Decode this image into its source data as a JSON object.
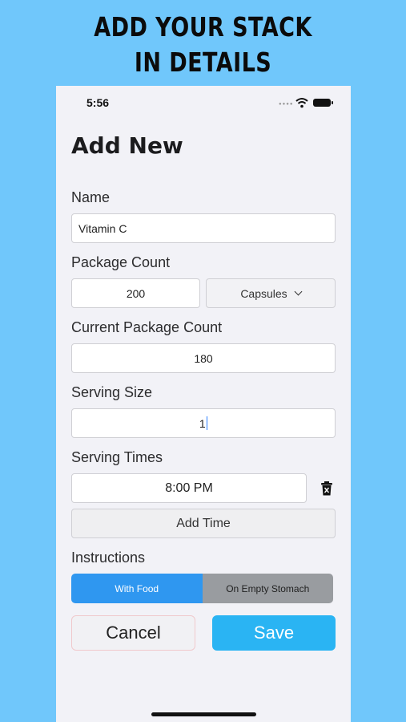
{
  "headline": {
    "line1": "ADD YOUR STACK",
    "line2": "IN DETAILS"
  },
  "status_bar": {
    "time": "5:56",
    "signal_icon": "signal-dots-icon",
    "wifi_icon": "wifi-icon",
    "battery_icon": "battery-icon"
  },
  "page": {
    "title": "Add New"
  },
  "form": {
    "name": {
      "label": "Name",
      "value": "Vitamin C"
    },
    "package_count": {
      "label": "Package Count",
      "value": "200",
      "unit_selected": "Capsules"
    },
    "current_package_count": {
      "label": "Current Package Count",
      "value": "180"
    },
    "serving_size": {
      "label": "Serving Size",
      "value": "1"
    },
    "serving_times": {
      "label": "Serving Times",
      "times": [
        "8:00 PM"
      ],
      "add_label": "Add Time",
      "delete_icon": "trash-icon"
    },
    "instructions": {
      "label": "Instructions",
      "options": [
        "With Food",
        "On Empty Stomach"
      ],
      "selected": "With Food"
    }
  },
  "actions": {
    "cancel_label": "Cancel",
    "save_label": "Save"
  },
  "colors": {
    "background": "#70c7fb",
    "accent_blue": "#2f97f0",
    "save_blue": "#2ab4f3",
    "segment_off": "#999ca0"
  }
}
